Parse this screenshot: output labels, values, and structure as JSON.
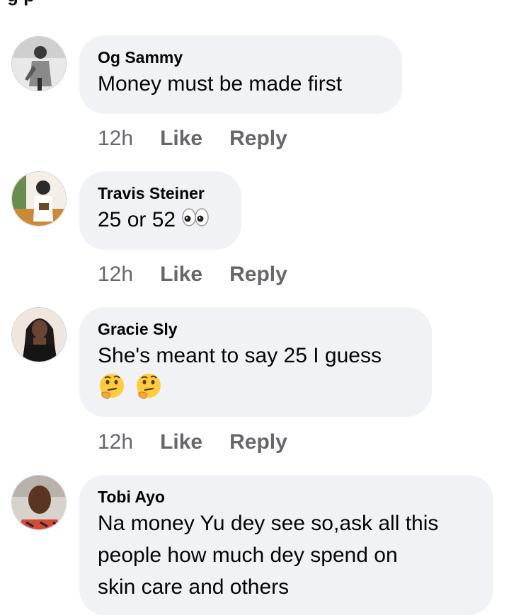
{
  "header": {
    "partial_title": "g  p"
  },
  "comments": [
    {
      "author": "Og Sammy",
      "text": "Money must be made first",
      "time": "12h",
      "like_label": "Like",
      "reply_label": "Reply"
    },
    {
      "author": "Travis Steiner",
      "text": "25 or 52",
      "time": "12h",
      "like_label": "Like",
      "reply_label": "Reply",
      "emoji": "eyes-emoji"
    },
    {
      "author": "Gracie Sly",
      "text": "She's meant to say 25 I guess",
      "time": "12h",
      "like_label": "Like",
      "reply_label": "Reply",
      "emoji": "thinking-face-emoji"
    },
    {
      "author": "Tobi Ayo",
      "text_lines": [
        "Na money Yu dey see so,ask all this",
        "people how much dey spend on",
        "skin care and others"
      ]
    }
  ],
  "colors": {
    "bubble": "#f0f2f5",
    "meta": "#65676b",
    "text": "#050505"
  }
}
